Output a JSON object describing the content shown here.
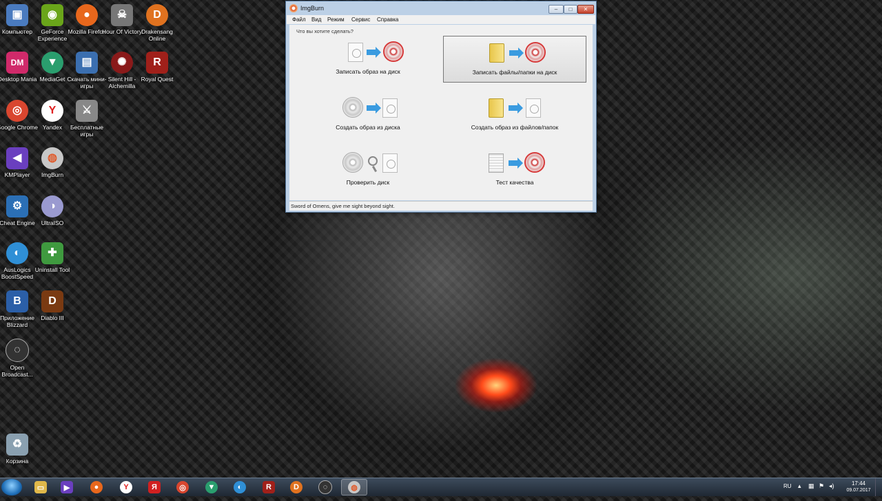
{
  "desktop": {
    "icons": [
      {
        "label": "Компьютер",
        "glyph": "▣",
        "color": "#4a7bbf"
      },
      {
        "label": "GeForce Experience",
        "glyph": "◉",
        "color": "#6aa51a"
      },
      {
        "label": "Mozilla Firefox",
        "glyph": "●",
        "color": "#e8671c"
      },
      {
        "label": "Hour Of Victory",
        "glyph": "☠",
        "color": "#777777"
      },
      {
        "label": "Drakensang Online",
        "glyph": "D",
        "color": "#e0721f"
      },
      {
        "label": "Desktop Mania",
        "glyph": "DM",
        "color": "#d02a6a"
      },
      {
        "label": "MediaGet",
        "glyph": "▼",
        "color": "#2a9e6e"
      },
      {
        "label": "Скачать мини-игры",
        "glyph": "▤",
        "color": "#3b6fb0"
      },
      {
        "label": "Silent Hill - Alchemilla",
        "glyph": "✺",
        "color": "#8a1a1a"
      },
      {
        "label": "Royal Quest",
        "glyph": "R",
        "color": "#a0201a"
      },
      {
        "label": "Google Chrome",
        "glyph": "◎",
        "color": "#d9462f"
      },
      {
        "label": "Yandex",
        "glyph": "Y",
        "color": "#e02020"
      },
      {
        "label": "Бесплатные игры",
        "glyph": "⚔",
        "color": "#888888"
      },
      {
        "label": "KMPlayer",
        "glyph": "◀",
        "color": "#6a3fbf"
      },
      {
        "label": "ImgBurn",
        "glyph": "◍",
        "color": "#c7c7c7"
      },
      {
        "label": "Cheat Engine",
        "glyph": "⚙",
        "color": "#2b6fb5"
      },
      {
        "label": "UltraISO",
        "glyph": "◑",
        "color": "#9a9ad0"
      },
      {
        "label": "AusLogics BoostSpeed",
        "glyph": "◐",
        "color": "#2f8fd6"
      },
      {
        "label": "Uninstall Tool",
        "glyph": "✚",
        "color": "#3f9a3f"
      },
      {
        "label": "Приложение Blizzard",
        "glyph": "B",
        "color": "#2b5fa8"
      },
      {
        "label": "Diablo III",
        "glyph": "D",
        "color": "#7a3a12"
      },
      {
        "label": "Open Broadcast...",
        "glyph": "◌",
        "color": "#333333"
      },
      {
        "label": "Корзина",
        "glyph": "♻",
        "color": "#8aa0b0"
      }
    ]
  },
  "window": {
    "title": "ImgBurn",
    "controls": {
      "minimize": "–",
      "maximize": "□",
      "close": "✕"
    },
    "menu": [
      "Файл",
      "Вид",
      "Режим",
      "Сервис",
      "Справка"
    ],
    "prompt": "Что вы хотите сделать?",
    "tiles": [
      {
        "label": "Записать образ на диск"
      },
      {
        "label": "Записать файлы/папки на диск"
      },
      {
        "label": "Создать образ из диска"
      },
      {
        "label": "Создать образ из файлов/папок"
      },
      {
        "label": "Проверить диск"
      },
      {
        "label": "Тест качества"
      }
    ],
    "status": "Sword of Omens, give me sight beyond sight."
  },
  "taskbar": {
    "items": [
      {
        "name": "explorer",
        "glyph": "▭",
        "color": "#e0b84a"
      },
      {
        "name": "kmplayer",
        "glyph": "▶",
        "color": "#6a3fbf"
      },
      {
        "name": "firefox",
        "glyph": "●",
        "color": "#e8671c"
      },
      {
        "name": "yandex-browser",
        "glyph": "Y",
        "color": "#e02020"
      },
      {
        "name": "yandex",
        "glyph": "Я",
        "color": "#d02020"
      },
      {
        "name": "chrome",
        "glyph": "◎",
        "color": "#d9462f"
      },
      {
        "name": "mediaget",
        "glyph": "▼",
        "color": "#2a9e6e"
      },
      {
        "name": "auslogics",
        "glyph": "◐",
        "color": "#2f8fd6"
      },
      {
        "name": "royal-quest",
        "glyph": "R",
        "color": "#a0201a"
      },
      {
        "name": "drakensang",
        "glyph": "D",
        "color": "#e0721f"
      },
      {
        "name": "obs",
        "glyph": "◌",
        "color": "#333333"
      },
      {
        "name": "imgburn",
        "glyph": "◍",
        "color": "#c7c7c7"
      }
    ],
    "language": "RU",
    "time": "17:44",
    "date": "09.07.2017"
  }
}
